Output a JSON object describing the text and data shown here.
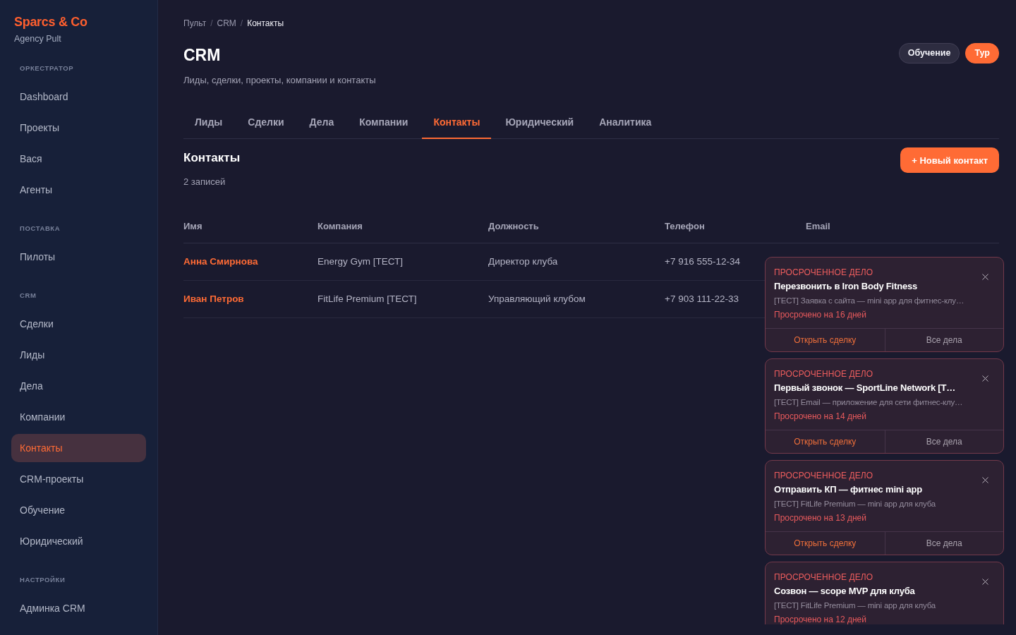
{
  "sidebar": {
    "brand": "Sparcs & Co",
    "subtitle": "Agency Pult",
    "sections": [
      {
        "title": "ОРКЕСТРАТОР",
        "items": [
          {
            "label": "Dashboard",
            "selected": false
          },
          {
            "label": "Проекты",
            "selected": false
          },
          {
            "label": "Вася",
            "selected": false
          },
          {
            "label": "Агенты",
            "selected": false
          }
        ]
      },
      {
        "title": "ПОСТАВКА",
        "items": [
          {
            "label": "Пилоты",
            "selected": false
          }
        ]
      },
      {
        "title": "CRM",
        "items": [
          {
            "label": "Сделки",
            "selected": false
          },
          {
            "label": "Лиды",
            "selected": false
          },
          {
            "label": "Дела",
            "selected": false
          },
          {
            "label": "Компании",
            "selected": false
          },
          {
            "label": "Контакты",
            "selected": true
          },
          {
            "label": "CRM-проекты",
            "selected": false
          },
          {
            "label": "Обучение",
            "selected": false
          },
          {
            "label": "Юридический",
            "selected": false
          }
        ]
      },
      {
        "title": "НАСТРОЙКИ",
        "items": [
          {
            "label": "Админка CRM",
            "selected": false
          }
        ]
      }
    ]
  },
  "breadcrumbs": [
    {
      "label": "Пульт",
      "current": false
    },
    {
      "separator": "/",
      "label": "CRM",
      "current": false
    },
    {
      "separator": "/",
      "label": "Контакты",
      "current": true
    }
  ],
  "page": {
    "title": "CRM",
    "subtitle": "Лиды, сделки, проекты, компании и контакты",
    "buttons": [
      {
        "label": "Обучение",
        "kind": "secondary"
      },
      {
        "label": "Тур",
        "kind": "primary"
      }
    ]
  },
  "tabs": [
    {
      "label": "Лиды",
      "selected": false
    },
    {
      "label": "Сделки",
      "selected": false
    },
    {
      "label": "Дела",
      "selected": false
    },
    {
      "label": "Компании",
      "selected": false
    },
    {
      "label": "Контакты",
      "selected": true
    },
    {
      "label": "Юридический",
      "selected": false
    },
    {
      "label": "Аналитика",
      "selected": false
    }
  ],
  "section": {
    "title": "Контакты",
    "count": "2 записей",
    "button": "+ Новый контакт"
  },
  "table": {
    "columns": [
      "Имя",
      "Компания",
      "Должность",
      "Телефон",
      "Email"
    ],
    "rows": [
      {
        "cells": [
          "Анна Смирнова",
          "Energy Gym [ТЕСТ]",
          "Директор клуба",
          "+7 916 555-12-34"
        ]
      },
      {
        "cells": [
          "Иван Петров",
          "FitLife Premium [ТЕСТ]",
          "Управляющий клубом",
          "+7 903 111-22-33"
        ]
      }
    ]
  },
  "notifications": [
    {
      "label": "ПРОСРОЧЕННОЕ ДЕЛО",
      "title": "Перезвонить в Iron Body Fitness",
      "description": "[ТЕСТ] Заявка с сайта — mini app для фитнес-клу…",
      "overdue": "Просрочено на 16 дней",
      "actions": [
        {
          "label": "Открыть сделку",
          "kind": "primary"
        },
        {
          "label": "Все дела",
          "kind": "secondary"
        }
      ]
    },
    {
      "label": "ПРОСРОЧЕННОЕ ДЕЛО",
      "title": "Первый звонок — SportLine Network [Т…",
      "description": "[ТЕСТ] Email — приложение для сети фитнес-клу…",
      "overdue": "Просрочено на 14 дней",
      "actions": [
        {
          "label": "Открыть сделку",
          "kind": "primary"
        },
        {
          "label": "Все дела",
          "kind": "secondary"
        }
      ]
    },
    {
      "label": "ПРОСРОЧЕННОЕ ДЕЛО",
      "title": "Отправить КП — фитнес mini app",
      "description": "[ТЕСТ] FitLife Premium — mini app для клуба",
      "overdue": "Просрочено на 13 дней",
      "actions": [
        {
          "label": "Открыть сделку",
          "kind": "primary"
        },
        {
          "label": "Все дела",
          "kind": "secondary"
        }
      ]
    },
    {
      "label": "ПРОСРОЧЕННОЕ ДЕЛО",
      "title": "Созвон — scope MVP для клуба",
      "description": "[ТЕСТ] FitLife Premium — mini app для клуба",
      "overdue": "Просрочено на 12 дней"
    }
  ]
}
